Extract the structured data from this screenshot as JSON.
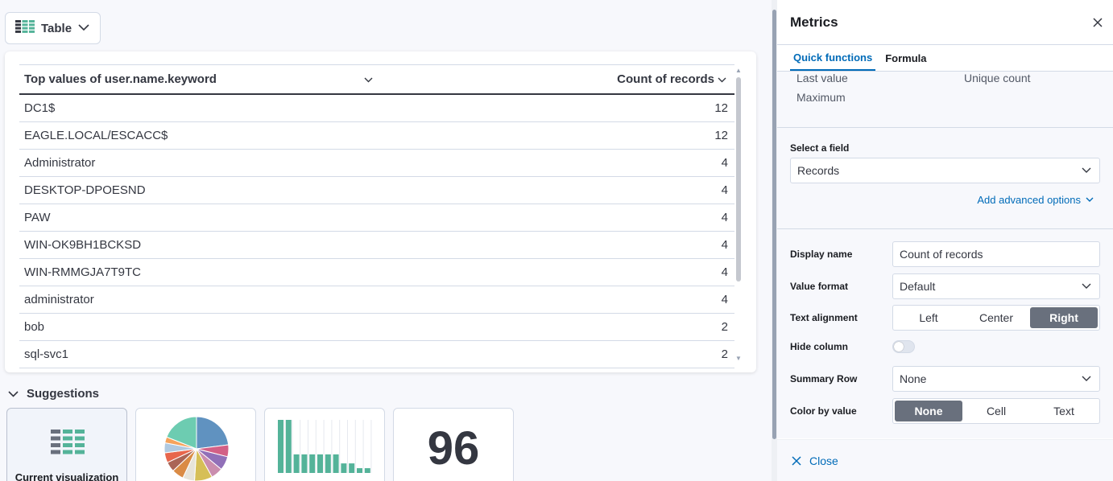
{
  "chart_switcher": {
    "label": "Table",
    "icon": "table-icon"
  },
  "table": {
    "columns": [
      {
        "label": "Top values of user.name.keyword"
      },
      {
        "label": "Count of records"
      }
    ],
    "rows": [
      {
        "name": "DC1$",
        "count": "12"
      },
      {
        "name": "EAGLE.LOCAL/ESCACC$",
        "count": "12"
      },
      {
        "name": "Administrator",
        "count": "4"
      },
      {
        "name": "DESKTOP-DPOESND",
        "count": "4"
      },
      {
        "name": "PAW",
        "count": "4"
      },
      {
        "name": "WIN-OK9BH1BCKSD",
        "count": "4"
      },
      {
        "name": "WIN-RMMGJA7T9TC",
        "count": "4"
      },
      {
        "name": "administrator",
        "count": "4"
      },
      {
        "name": "bob",
        "count": "2"
      },
      {
        "name": "sql-svc1",
        "count": "2"
      }
    ]
  },
  "suggestions": {
    "title": "Suggestions",
    "items": [
      {
        "caption": "Current visualization",
        "icon": "table-icon"
      },
      {
        "caption": "",
        "icon": "pie-chart-thumbnail"
      },
      {
        "caption": "",
        "icon": "bar-chart-thumbnail"
      },
      {
        "caption": "",
        "value": "96",
        "icon": "metric-thumbnail"
      }
    ],
    "colors": {
      "teal": "#54b399",
      "pie": [
        "#6092c0",
        "#d36086",
        "#9170b8",
        "#ca8eae",
        "#d6bf57",
        "#e7e4d9",
        "#da8b45",
        "#aa6556",
        "#e7664c",
        "#b0c9e0",
        "#f5a35c",
        "#6dccb1"
      ]
    }
  },
  "panel": {
    "title": "Metrics",
    "tabs": [
      "Quick functions",
      "Formula"
    ],
    "quick_functions": [
      "Last value",
      "Unique count",
      "Maximum"
    ],
    "select_field": {
      "label": "Select a field",
      "value": "Records"
    },
    "advanced_link": "Add advanced options",
    "display_name": {
      "label": "Display name",
      "value": "Count of records"
    },
    "value_format": {
      "label": "Value format",
      "value": "Default"
    },
    "text_alignment": {
      "label": "Text alignment",
      "options": [
        "Left",
        "Center",
        "Right"
      ],
      "selected": "Right"
    },
    "hide_column": {
      "label": "Hide column",
      "on": false
    },
    "summary_row": {
      "label": "Summary Row",
      "value": "None"
    },
    "color_by_value": {
      "label": "Color by value",
      "options": [
        "None",
        "Cell",
        "Text"
      ],
      "selected": "None"
    },
    "close_label": "Close"
  },
  "colors": {
    "accent": "#006bb8",
    "selected_segment": "#69707d"
  }
}
